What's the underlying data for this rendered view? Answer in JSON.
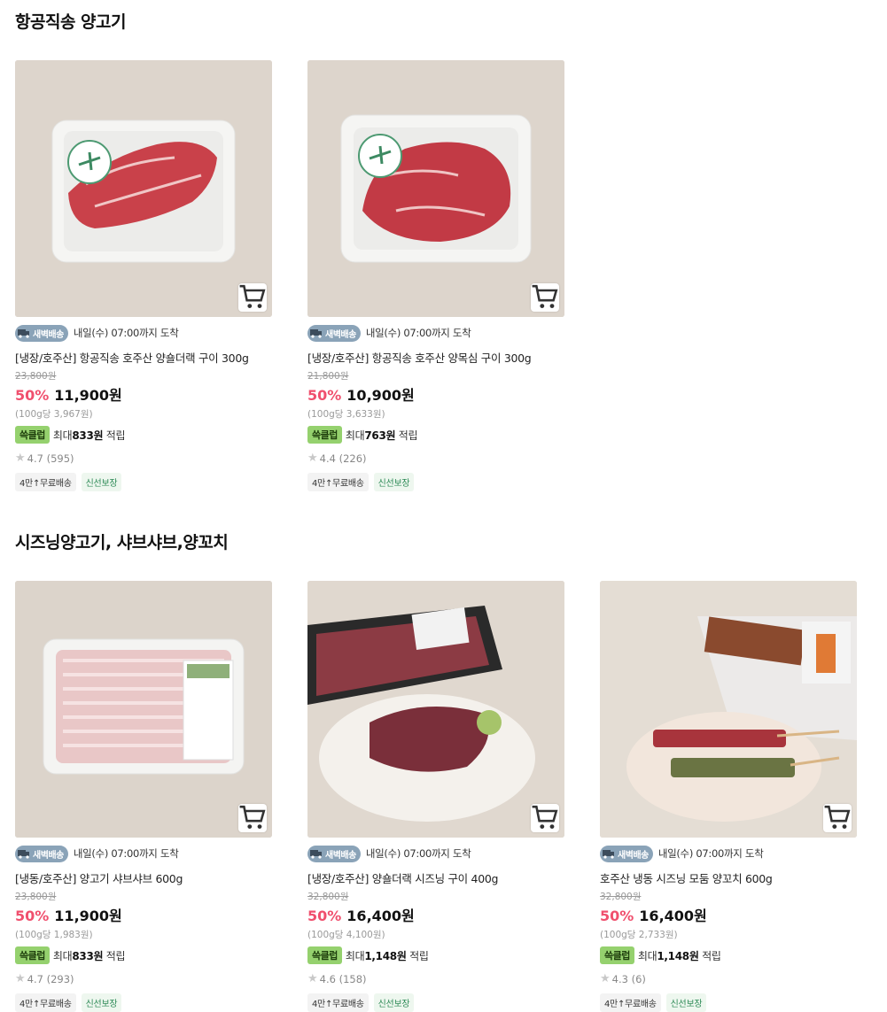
{
  "sections": [
    {
      "title": "항공직송 양고기",
      "products": [
        {
          "delivery_badge": "새벽배송",
          "delivery_text": "내일(수) 07:00까지 도착",
          "name": "[냉장/호주산] 항공직송 호주산 양숄더랙 구이 300g",
          "original_price": "23,800원",
          "discount": "50%",
          "price": "11,900원",
          "unit_price": "(100g당 3,967원)",
          "reward_badge": "쓱클럽",
          "reward_prefix": "최대",
          "reward_amount": "833원",
          "reward_suffix": "적립",
          "rating": "4.7",
          "reviews": "(595)",
          "tag1": "4만↑무료배송",
          "tag2": "신선보장"
        },
        {
          "delivery_badge": "새벽배송",
          "delivery_text": "내일(수) 07:00까지 도착",
          "name": "[냉장/호주산] 항공직송 호주산 양목심 구이 300g",
          "original_price": "21,800원",
          "discount": "50%",
          "price": "10,900원",
          "unit_price": "(100g당 3,633원)",
          "reward_badge": "쓱클럽",
          "reward_prefix": "최대",
          "reward_amount": "763원",
          "reward_suffix": "적립",
          "rating": "4.4",
          "reviews": "(226)",
          "tag1": "4만↑무료배송",
          "tag2": "신선보장"
        }
      ]
    },
    {
      "title": "시즈닝양고기, 샤브샤브,양꼬치",
      "products": [
        {
          "delivery_badge": "새벽배송",
          "delivery_text": "내일(수) 07:00까지 도착",
          "name": "[냉동/호주산] 양고기 샤브샤브 600g",
          "original_price": "23,800원",
          "discount": "50%",
          "price": "11,900원",
          "unit_price": "(100g당 1,983원)",
          "reward_badge": "쓱클럽",
          "reward_prefix": "최대",
          "reward_amount": "833원",
          "reward_suffix": "적립",
          "rating": "4.7",
          "reviews": "(293)",
          "tag1": "4만↑무료배송",
          "tag2": "신선보장"
        },
        {
          "delivery_badge": "새벽배송",
          "delivery_text": "내일(수) 07:00까지 도착",
          "name": "[냉장/호주산] 양숄더랙 시즈닝 구이 400g",
          "original_price": "32,800원",
          "discount": "50%",
          "price": "16,400원",
          "unit_price": "(100g당 4,100원)",
          "reward_badge": "쓱클럽",
          "reward_prefix": "최대",
          "reward_amount": "1,148원",
          "reward_suffix": "적립",
          "rating": "4.6",
          "reviews": "(158)",
          "tag1": "4만↑무료배송",
          "tag2": "신선보장"
        },
        {
          "delivery_badge": "새벽배송",
          "delivery_text": "내일(수) 07:00까지 도착",
          "name": "호주산 냉동 시즈닝 모둠 양꼬치 600g",
          "original_price": "32,800원",
          "discount": "50%",
          "price": "16,400원",
          "unit_price": "(100g당 2,733원)",
          "reward_badge": "쓱클럽",
          "reward_prefix": "최대",
          "reward_amount": "1,148원",
          "reward_suffix": "적립",
          "rating": "4.3",
          "reviews": "(6)",
          "tag1": "4만↑무료배송",
          "tag2": "신선보장"
        }
      ]
    }
  ],
  "icons": {
    "cart": "cart-icon",
    "star": "star-icon",
    "truck": "truck-icon"
  },
  "colors": {
    "discount": "#f0506e",
    "reward_badge": "#95d16e",
    "delivery_badge": "#8aa3b8",
    "fresh_tag": "#2e8b57"
  }
}
